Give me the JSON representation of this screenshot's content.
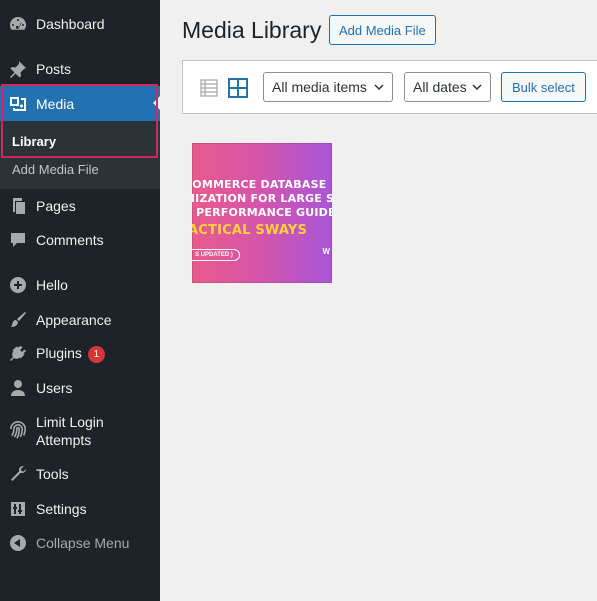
{
  "sidebar": {
    "items": [
      {
        "label": "Dashboard",
        "icon": "dashboard-icon"
      },
      {
        "label": "Posts",
        "icon": "pin-icon"
      },
      {
        "label": "Media",
        "icon": "media-icon"
      },
      {
        "label": "Pages",
        "icon": "pages-icon"
      },
      {
        "label": "Comments",
        "icon": "comments-icon"
      },
      {
        "label": "Hello",
        "icon": "plus-circle-icon"
      },
      {
        "label": "Appearance",
        "icon": "brush-icon"
      },
      {
        "label": "Plugins",
        "icon": "plug-icon",
        "badge": "1"
      },
      {
        "label": "Users",
        "icon": "user-icon"
      },
      {
        "label": "Limit Login Attempts",
        "line1": "Limit Login",
        "line2": "Attempts",
        "icon": "fingerprint-icon"
      },
      {
        "label": "Tools",
        "icon": "wrench-icon"
      },
      {
        "label": "Settings",
        "icon": "sliders-icon"
      }
    ],
    "submenu": [
      {
        "label": "Library"
      },
      {
        "label": "Add Media File"
      }
    ],
    "collapse_label": "Collapse Menu"
  },
  "header": {
    "title": "Media Library",
    "add_button": "Add Media File"
  },
  "toolbar": {
    "media_filter": "All media items",
    "date_filter": "All dates",
    "bulk_select": "Bulk select"
  },
  "media": {
    "items": [
      {
        "line1": "COMMERCE DATABASE",
        "line2": "MIZATION FOR LARGE STORES",
        "line3": "S PERFORMANCE GUIDE)",
        "line4": "ACTICAL SWAYS",
        "pill": "S UPDATED )",
        "mark": "W"
      }
    ]
  },
  "colors": {
    "sidebar_bg": "#1d2327",
    "active": "#2271b1",
    "highlight": "#d6245f",
    "badge": "#d63638"
  }
}
